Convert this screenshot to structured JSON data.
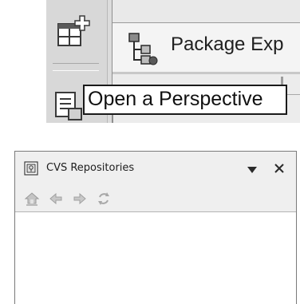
{
  "top": {
    "package_explorer_tab_label": "Package Exp",
    "tooltip_text": "Open a Perspective",
    "icons": {
      "open_perspective": "open-perspective-icon",
      "package_explorer": "package-explorer-icon",
      "java_perspective": "java-perspective-icon"
    }
  },
  "cvs_view": {
    "title": "CVS Repositories",
    "view_menu_icon": "chevron-down-icon",
    "close_icon": "close-icon",
    "toolbar": [
      {
        "name": "home-icon",
        "enabled": false
      },
      {
        "name": "back-icon",
        "enabled": false
      },
      {
        "name": "forward-icon",
        "enabled": false
      },
      {
        "name": "refresh-icon",
        "enabled": false
      }
    ]
  },
  "colors": {
    "toolbar_bg": "#efefef",
    "panel_bg": "#dcdcdc",
    "disabled_icon": "#b0b0b0",
    "text": "#202020"
  }
}
